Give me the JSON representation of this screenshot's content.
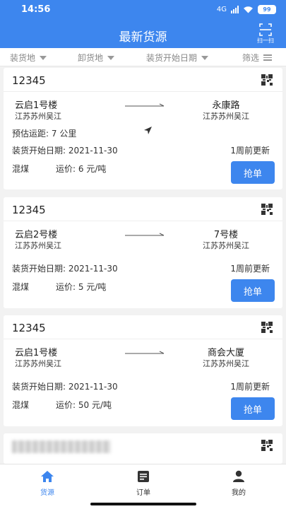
{
  "status_bar": {
    "time": "14:56",
    "network": "4G",
    "battery": "99"
  },
  "header": {
    "title": "最新货源",
    "scan_label": "扫一扫"
  },
  "filters": {
    "load_place": "装货地",
    "unload_place": "卸货地",
    "load_date": "装货开始日期",
    "filter": "筛选"
  },
  "labels": {
    "distance_prefix": "预估运距:",
    "date_prefix": "装货开始日期:",
    "price_prefix": "运价:",
    "grab_button": "抢单"
  },
  "cards": [
    {
      "id": "12345",
      "from_place": "云启1号楼",
      "from_area": "江苏苏州吴江",
      "to_place": "永康路",
      "to_area": "江苏苏州吴江",
      "distance": "7 公里",
      "start_date": "2021-11-30",
      "updated": "1周前更新",
      "cargo": "混煤",
      "price": "6 元/吨"
    },
    {
      "id": "12345",
      "from_place": "云启2号楼",
      "from_area": "江苏苏州吴江",
      "to_place": "7号楼",
      "to_area": "江苏苏州吴江",
      "start_date": "2021-11-30",
      "updated": "1周前更新",
      "cargo": "混煤",
      "price": "5 元/吨"
    },
    {
      "id": "12345",
      "from_place": "云启1号楼",
      "from_area": "江苏苏州吴江",
      "to_place": "商会大厦",
      "to_area": "江苏苏州吴江",
      "start_date": "2021-11-30",
      "updated": "1周前更新",
      "cargo": "混煤",
      "price": "50 元/吨"
    }
  ],
  "tabs": [
    {
      "label": "货源",
      "icon": "home-icon",
      "active": true
    },
    {
      "label": "订单",
      "icon": "order-icon",
      "active": false
    },
    {
      "label": "我的",
      "icon": "user-icon",
      "active": false
    }
  ],
  "colors": {
    "primary": "#3d86ee",
    "background": "#f2f2f2"
  }
}
